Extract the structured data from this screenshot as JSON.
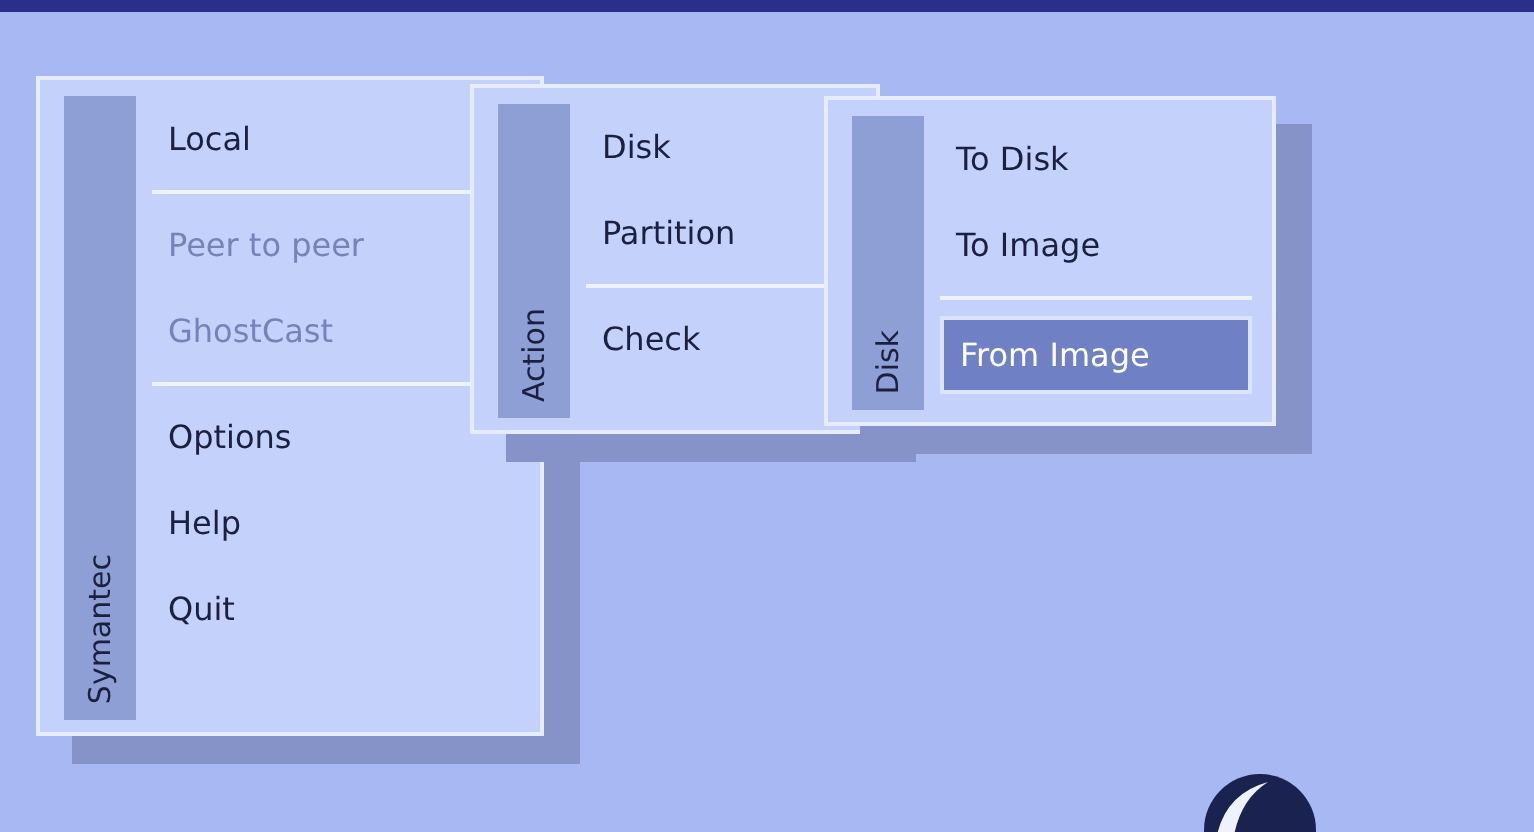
{
  "menus": [
    {
      "title": "Symantec",
      "items": [
        {
          "kind": "item",
          "label": "Local",
          "disabled": false,
          "selected": false
        },
        {
          "kind": "separator"
        },
        {
          "kind": "item",
          "label": "Peer to peer",
          "disabled": true,
          "selected": false
        },
        {
          "kind": "item",
          "label": "GhostCast",
          "disabled": true,
          "selected": false
        },
        {
          "kind": "separator"
        },
        {
          "kind": "item",
          "label": "Options",
          "disabled": false,
          "selected": false
        },
        {
          "kind": "item",
          "label": "Help",
          "disabled": false,
          "selected": false
        },
        {
          "kind": "item",
          "label": "Quit",
          "disabled": false,
          "selected": false
        }
      ]
    },
    {
      "title": "Action",
      "items": [
        {
          "kind": "item",
          "label": "Disk",
          "disabled": false,
          "selected": false
        },
        {
          "kind": "item",
          "label": "Partition",
          "disabled": false,
          "selected": false
        },
        {
          "kind": "separator"
        },
        {
          "kind": "item",
          "label": "Check",
          "disabled": false,
          "selected": false
        }
      ]
    },
    {
      "title": "Disk",
      "items": [
        {
          "kind": "item",
          "label": "To Disk",
          "disabled": false,
          "selected": false
        },
        {
          "kind": "item",
          "label": "To Image",
          "disabled": false,
          "selected": false
        },
        {
          "kind": "separator"
        },
        {
          "kind": "item",
          "label": "From Image",
          "disabled": false,
          "selected": true
        }
      ]
    }
  ]
}
